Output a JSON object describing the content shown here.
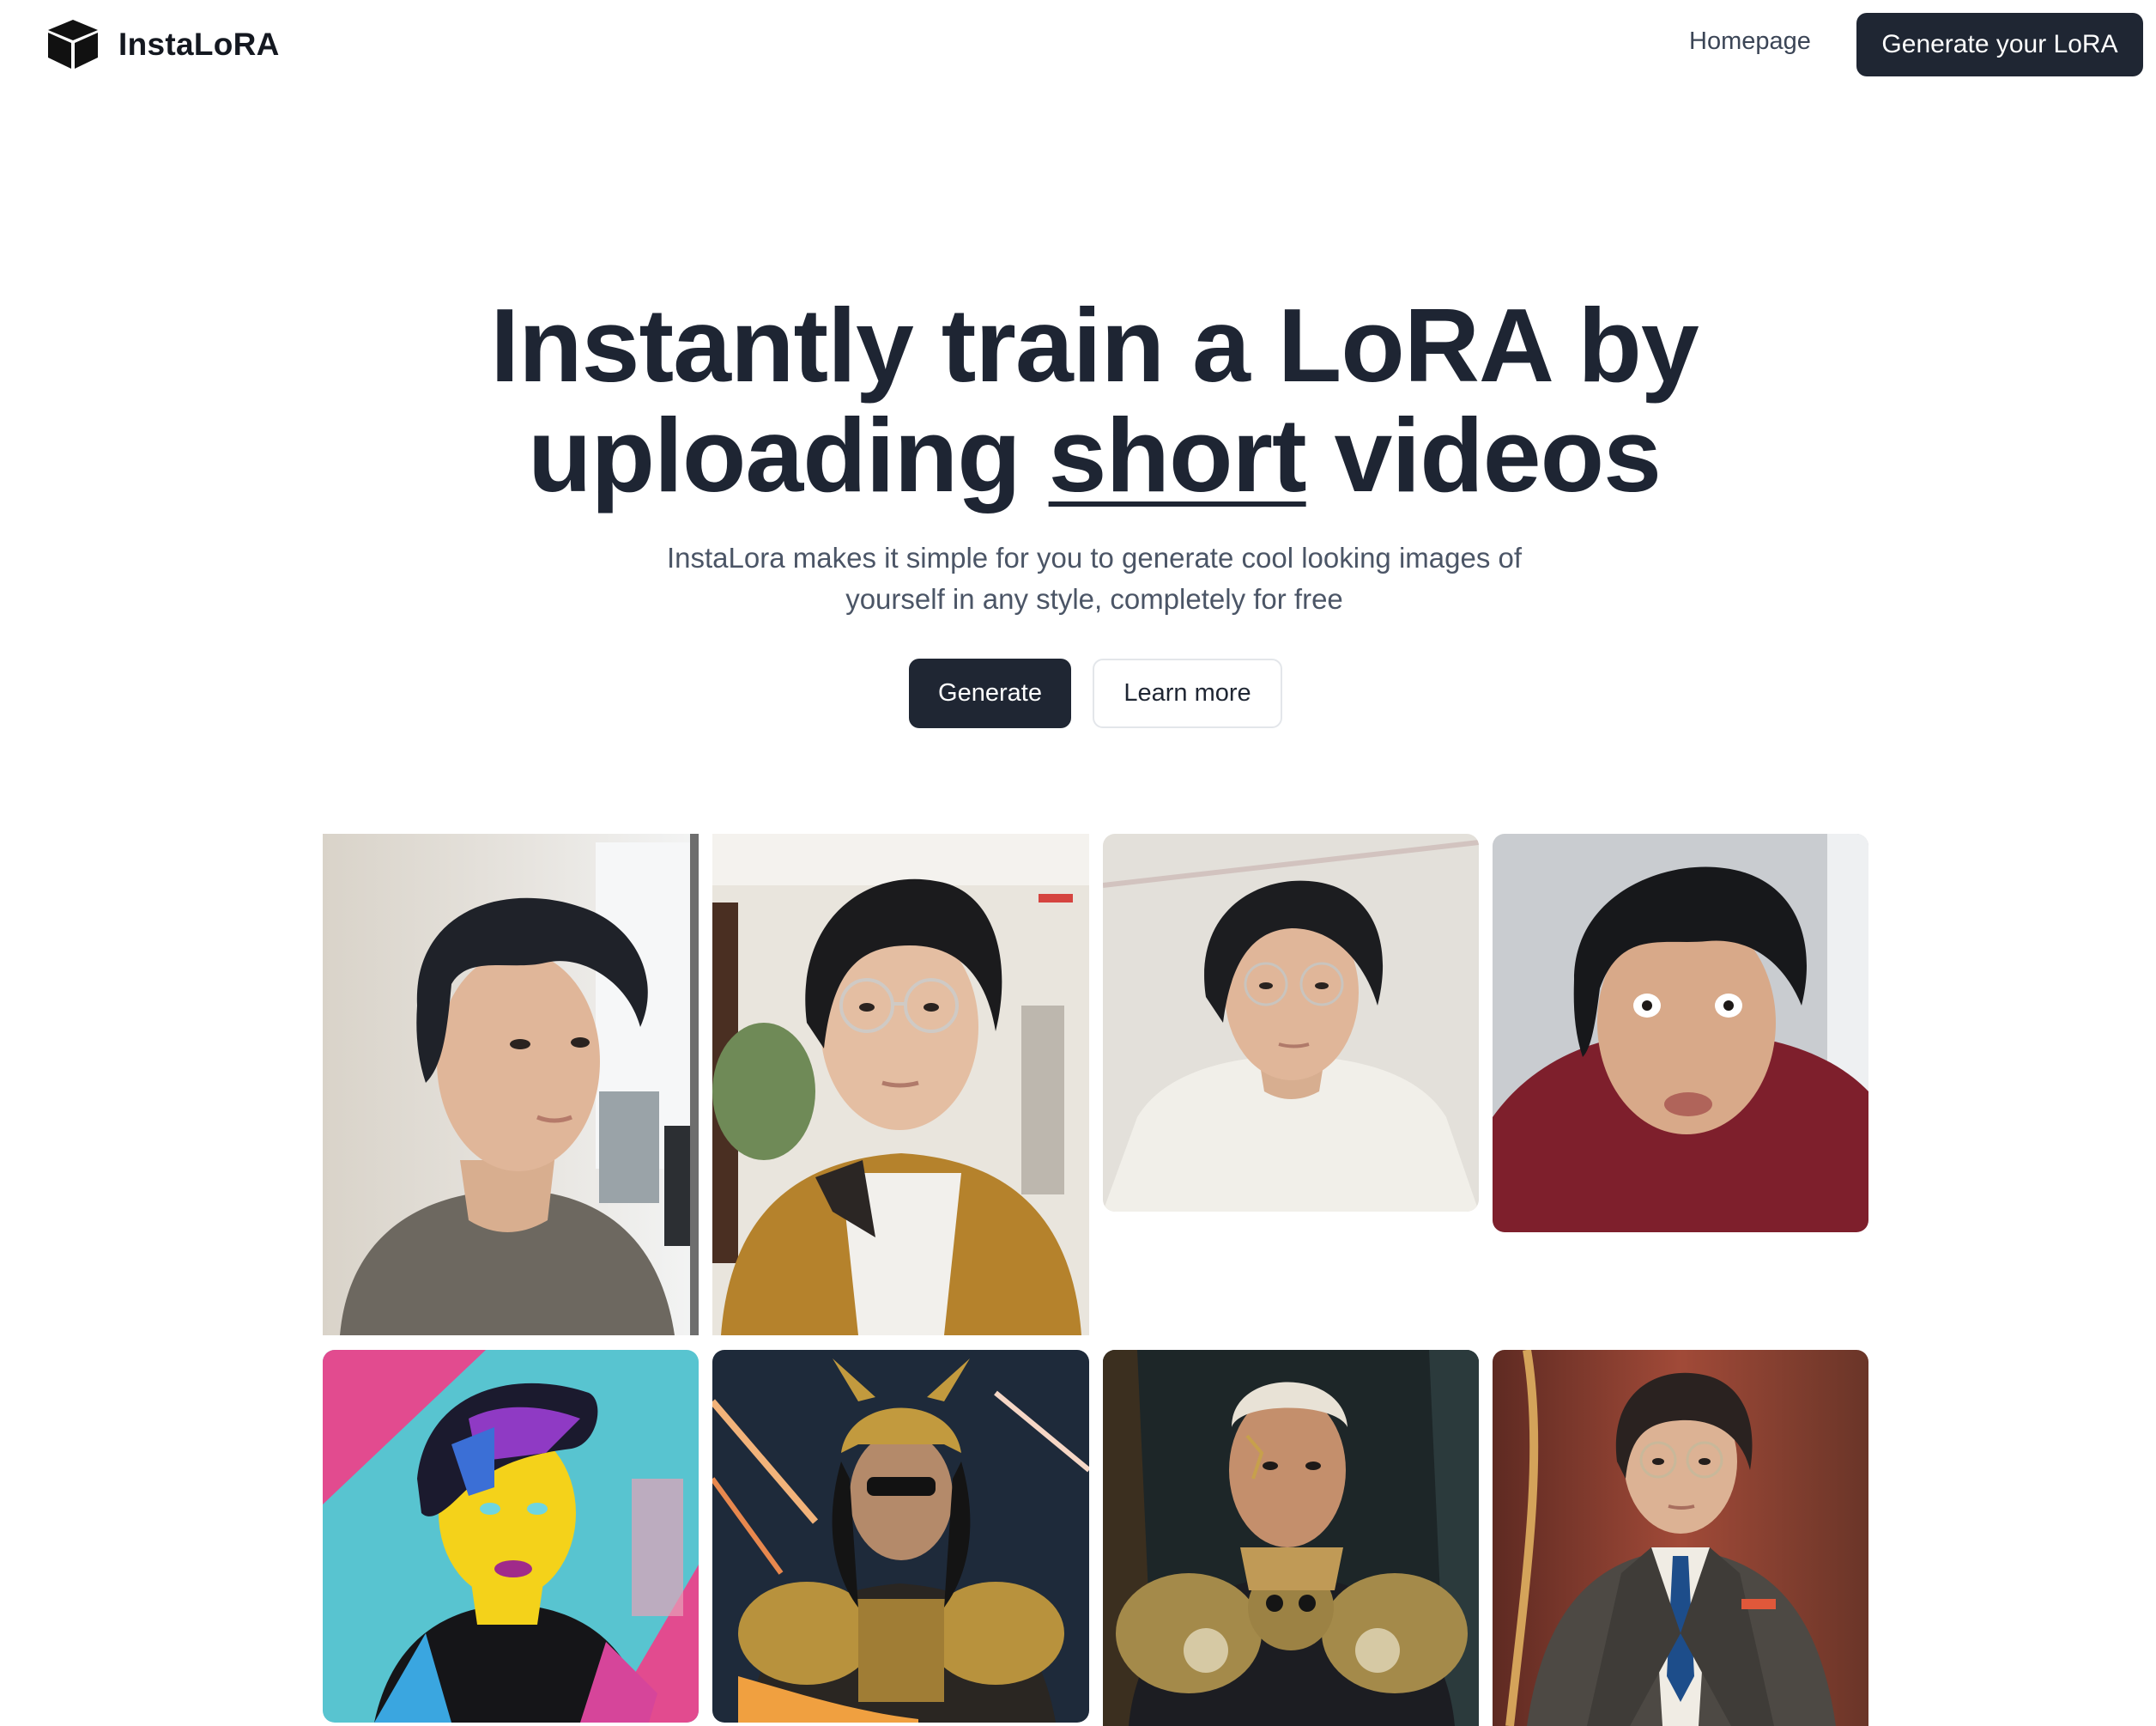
{
  "header": {
    "brand": "InstaLoRA",
    "nav_homepage": "Homepage",
    "cta": "Generate your LoRA"
  },
  "hero": {
    "title_line1": "Instantly train a LoRA by",
    "title_line2_pre": "uploading ",
    "title_line2_ul": "short",
    "title_line2_post": " videos",
    "subtitle_line1": "InstaLora makes it simple for you to generate cool looking images of",
    "subtitle_line2": "yourself in any style, completely for free",
    "generate": "Generate",
    "learn_more": "Learn more"
  },
  "gallery": {
    "images": [
      {
        "alt": "selfie-gray-shirt"
      },
      {
        "alt": "selfie-mustard-jacket"
      },
      {
        "alt": "selfie-white-shirt"
      },
      {
        "alt": "selfie-red-hoodie"
      },
      {
        "alt": "pop-art-portrait"
      },
      {
        "alt": "samurai-armor"
      },
      {
        "alt": "skull-armor-warrior"
      },
      {
        "alt": "suit-portrait"
      }
    ]
  },
  "colors": {
    "primary": "#1f2633",
    "text": "#1e2533",
    "muted": "#4b5566",
    "border": "#e3e6ea"
  }
}
